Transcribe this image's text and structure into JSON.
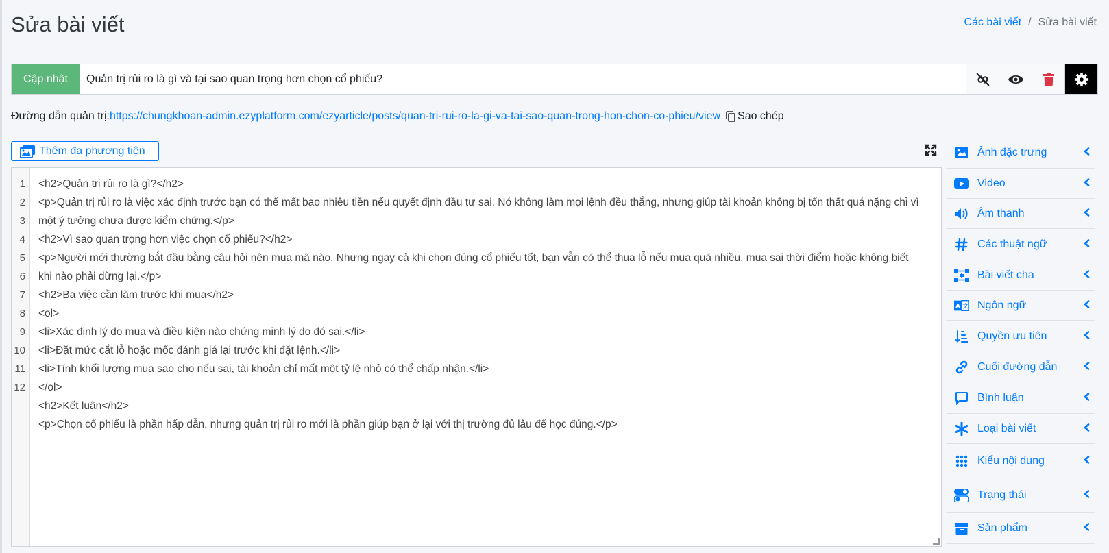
{
  "header": {
    "title": "Sửa bài viết",
    "breadcrumb_link": "Các bài viết",
    "breadcrumb_sep": "/",
    "breadcrumb_current": "Sửa bài viết"
  },
  "titlebar": {
    "update_label": "Cập nhật",
    "title_value": "Quản trị rủi ro là gì và tại sao quan trọng hơn chọn cổ phiếu?",
    "icons": [
      "unlink-icon",
      "eye-icon",
      "trash-icon",
      "gear-icon"
    ]
  },
  "admin_link": {
    "label": "Đường dẫn quản trị:",
    "url": "https://chungkhoan-admin.ezyplatform.com/ezyarticle/posts/quan-tri-rui-ro-la-gi-va-tai-sao-quan-trong-hon-chon-co-phieu/view",
    "copy_label": "Sao chép"
  },
  "media_button": {
    "label": "Thêm đa phương tiện"
  },
  "editor": {
    "line_numbers": [
      "1",
      "2",
      "3",
      "4",
      "5",
      "6",
      "7",
      "8",
      "9",
      "10",
      "11",
      "12"
    ],
    "lines": [
      "<h2>Quản trị rủi ro là gì?</h2>",
      "<p>Quản trị rủi ro là việc xác định trước bạn có thể mất bao nhiêu tiền nếu quyết định đầu tư sai. Nó không làm mọi lệnh đều thắng, nhưng giúp tài khoản không bị tổn thất quá nặng chỉ vì một ý tưởng chưa được kiểm chứng.</p>",
      "<h2>Vì sao quan trọng hơn việc chọn cổ phiếu?</h2>",
      "<p>Người mới thường bắt đầu bằng câu hỏi nên mua mã nào. Nhưng ngay cả khi chọn đúng cổ phiếu tốt, bạn vẫn có thể thua lỗ nếu mua quá nhiều, mua sai thời điểm hoặc không biết khi nào phải dừng lại.</p>",
      "<h2>Ba việc cần làm trước khi mua</h2>",
      "<ol>",
      "<li>Xác định lý do mua và điều kiện nào chứng minh lý do đó sai.</li>",
      "<li>Đặt mức cắt lỗ hoặc mốc đánh giá lại trước khi đặt lệnh.</li>",
      "<li>Tính khối lượng mua sao cho nếu sai, tài khoản chỉ mất một tỷ lệ nhỏ có thể chấp nhận.</li>",
      "</ol>",
      "<h2>Kết luận</h2>",
      "<p>Chọn cổ phiếu là phần hấp dẫn, nhưng quản trị rủi ro mới là phần giúp bạn ở lại với thị trường đủ lâu để học đúng.</p>"
    ]
  },
  "sidebar": {
    "items": [
      {
        "label": "Ảnh đặc trưng",
        "icon": "image-icon"
      },
      {
        "label": "Video",
        "icon": "youtube-icon"
      },
      {
        "label": "Âm thanh",
        "icon": "volume-icon"
      },
      {
        "label": "Các thuật ngữ",
        "icon": "hashtag-icon"
      },
      {
        "label": "Bài viết cha",
        "icon": "sitemap-icon"
      },
      {
        "label": "Ngôn ngữ",
        "icon": "language-icon"
      },
      {
        "label": "Quyền ưu tiên",
        "icon": "sort-icon"
      },
      {
        "label": "Cuối đường dẫn",
        "icon": "link-icon"
      },
      {
        "label": "Bình luận",
        "icon": "comment-icon"
      },
      {
        "label": "Loại bài viết",
        "icon": "asterisk-icon"
      },
      {
        "label": "Kiểu nội dung",
        "icon": "grid-icon"
      },
      {
        "label": "Trạng thái",
        "icon": "toggle-icon"
      },
      {
        "label": "Sản phẩm",
        "icon": "box-icon"
      }
    ]
  },
  "colors": {
    "primary": "#007bff",
    "success": "#5cb87a",
    "danger": "#dc3545"
  }
}
